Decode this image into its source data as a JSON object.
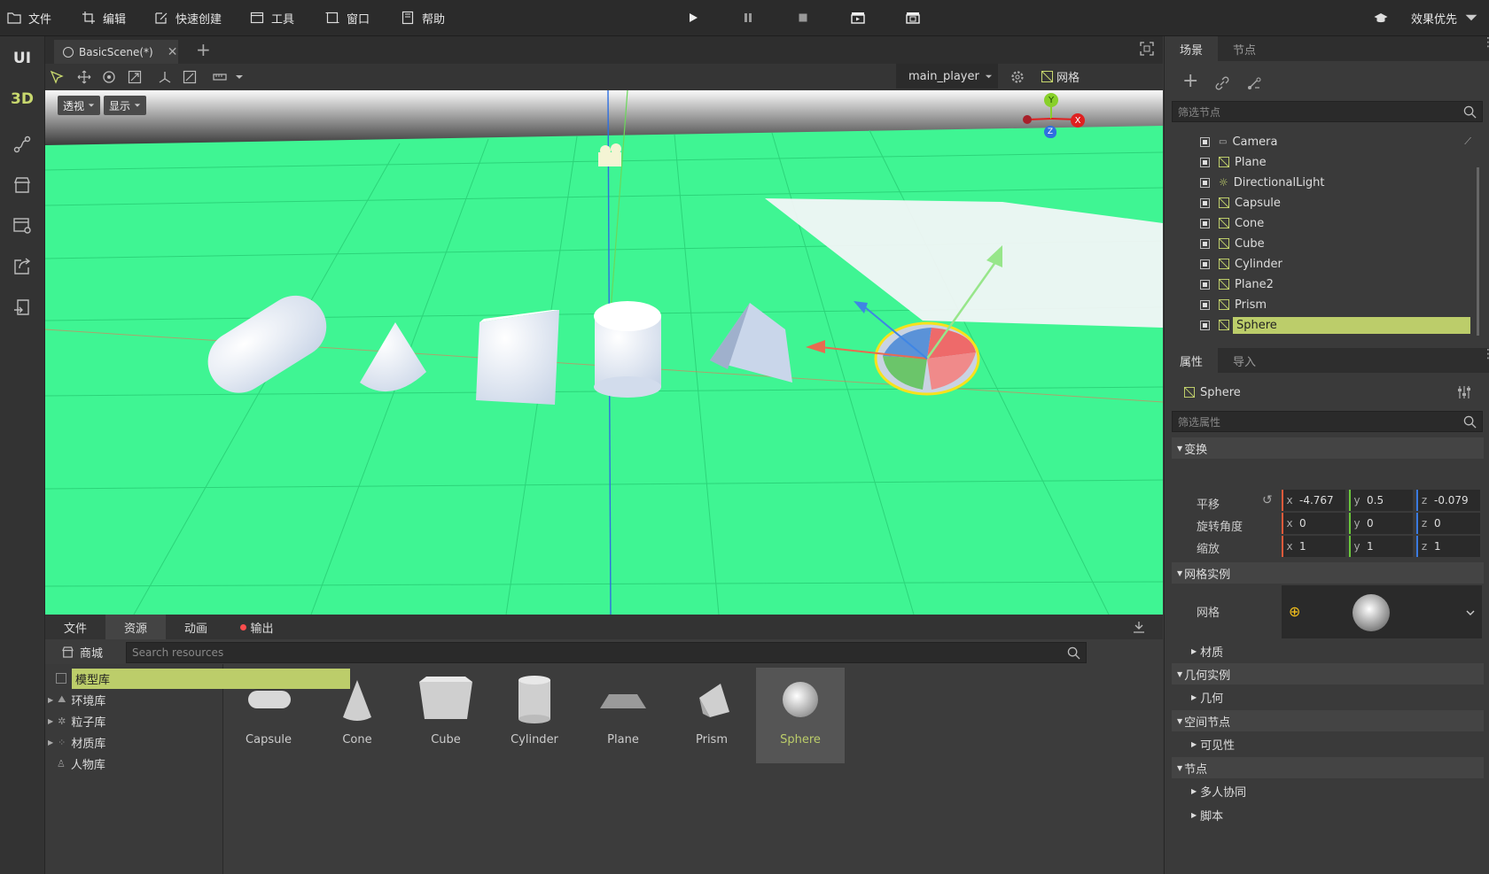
{
  "menu": {
    "file": "文件",
    "edit": "编辑",
    "quick_create": "快速创建",
    "tools": "工具",
    "window": "窗口",
    "help": "帮助",
    "quality": "效果优先"
  },
  "rail": {
    "ui": "UI",
    "threed": "3D"
  },
  "document": {
    "tab_title": "BasicScene(*)"
  },
  "viewport": {
    "camera_select": "main_player",
    "grid_label": "网格",
    "projection_button": "透视",
    "display_button": "显示",
    "gizmo_y": "Y",
    "gizmo_x": "X",
    "gizmo_z": "Z"
  },
  "bottom": {
    "tabs": [
      "文件",
      "资源",
      "动画",
      "输出"
    ],
    "active_tab": "资源",
    "store": "商城",
    "search_placeholder": "Search resources",
    "library": [
      "模型库",
      "环境库",
      "粒子库",
      "材质库",
      "人物库"
    ],
    "selected_library": "模型库",
    "assets": [
      "Capsule",
      "Cone",
      "Cube",
      "Cylinder",
      "Plane",
      "Prism",
      "Sphere"
    ],
    "selected_asset": "Sphere"
  },
  "scene_panel": {
    "tabs": [
      "场景",
      "节点"
    ],
    "filter_placeholder": "筛选节点",
    "nodes": [
      "Camera",
      "Plane",
      "DirectionalLight",
      "Capsule",
      "Cone",
      "Cube",
      "Cylinder",
      "Plane2",
      "Prism",
      "Sphere"
    ],
    "selected_node": "Sphere"
  },
  "properties": {
    "tabs": [
      "属性",
      "导入"
    ],
    "node_name": "Sphere",
    "filter_placeholder": "筛选属性",
    "transform": {
      "section": "变换",
      "position_label": "平移",
      "rotation_label": "旋转角度",
      "scale_label": "缩放",
      "position": {
        "x": "-4.767",
        "y": "0.5",
        "z": "-0.079"
      },
      "rotation": {
        "x": "0",
        "y": "0",
        "z": "0"
      },
      "scale": {
        "x": "1",
        "y": "1",
        "z": "1"
      },
      "axis_x": "x",
      "axis_y": "y",
      "axis_z": "z"
    },
    "mesh_instance": {
      "section": "网格实例",
      "mesh_label": "网格",
      "material": "材质"
    },
    "geometry_instance": {
      "section": "几何实例",
      "geometry": "几何"
    },
    "spatial": {
      "section": "空间节点",
      "visibility": "可见性"
    },
    "node": {
      "section": "节点",
      "multiplayer": "多人协同",
      "script": "脚本"
    }
  },
  "colors": {
    "accent": "#bccd6a",
    "viewport_ground": "#3ff593",
    "record_dot": "#ff4d4d"
  }
}
